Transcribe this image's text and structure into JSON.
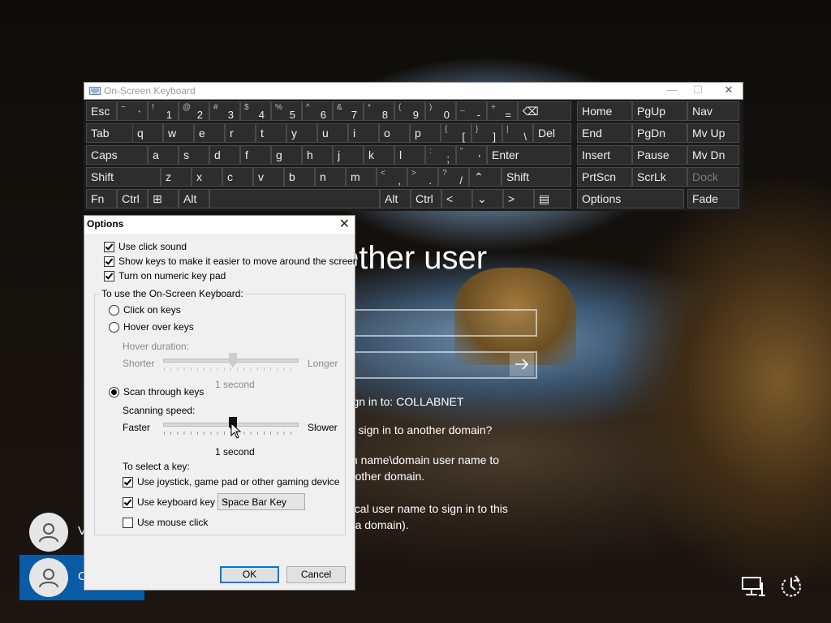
{
  "osk": {
    "title": "On-Screen Keyboard",
    "rows": [
      [
        {
          "main": "Esc"
        },
        {
          "sec": "~",
          "main": "`"
        },
        {
          "sec": "!",
          "main": "1"
        },
        {
          "sec": "@",
          "main": "2"
        },
        {
          "sec": "#",
          "main": "3"
        },
        {
          "sec": "$",
          "main": "4"
        },
        {
          "sec": "%",
          "main": "5"
        },
        {
          "sec": "^",
          "main": "6"
        },
        {
          "sec": "&",
          "main": "7"
        },
        {
          "sec": "*",
          "main": "8"
        },
        {
          "sec": "(",
          "main": "9"
        },
        {
          "sec": ")",
          "main": "0"
        },
        {
          "sec": "_",
          "main": "-"
        },
        {
          "sec": "+",
          "main": "="
        },
        {
          "main": "⌫"
        }
      ],
      [
        {
          "main": "Tab"
        },
        {
          "main": "q"
        },
        {
          "main": "w"
        },
        {
          "main": "e"
        },
        {
          "main": "r"
        },
        {
          "main": "t"
        },
        {
          "main": "y"
        },
        {
          "main": "u"
        },
        {
          "main": "i"
        },
        {
          "main": "o"
        },
        {
          "main": "p"
        },
        {
          "sec": "{",
          "main": "["
        },
        {
          "sec": "}",
          "main": "]"
        },
        {
          "sec": "|",
          "main": "\\"
        },
        {
          "main": "Del"
        }
      ],
      [
        {
          "main": "Caps"
        },
        {
          "main": "a"
        },
        {
          "main": "s"
        },
        {
          "main": "d"
        },
        {
          "main": "f"
        },
        {
          "main": "g"
        },
        {
          "main": "h"
        },
        {
          "main": "j"
        },
        {
          "main": "k"
        },
        {
          "main": "l"
        },
        {
          "sec": ":",
          "main": ";"
        },
        {
          "sec": "\"",
          "main": "'"
        },
        {
          "main": "Enter"
        }
      ],
      [
        {
          "main": "Shift"
        },
        {
          "main": "z"
        },
        {
          "main": "x"
        },
        {
          "main": "c"
        },
        {
          "main": "v"
        },
        {
          "main": "b"
        },
        {
          "main": "n"
        },
        {
          "main": "m"
        },
        {
          "sec": "<",
          "main": ","
        },
        {
          "sec": ">",
          "main": "."
        },
        {
          "sec": "?",
          "main": "/"
        },
        {
          "main": "⌃"
        },
        {
          "main": "Shift"
        }
      ],
      [
        {
          "main": "Fn"
        },
        {
          "main": "Ctrl"
        },
        {
          "main": "⊞"
        },
        {
          "main": "Alt"
        },
        {
          "main": ""
        },
        {
          "main": "Alt"
        },
        {
          "main": "Ctrl"
        },
        {
          "main": "<"
        },
        {
          "main": "⌄"
        },
        {
          "main": ">"
        },
        {
          "main": "▤"
        }
      ]
    ],
    "nav_keys": [
      [
        "Home",
        "PgUp",
        "Nav"
      ],
      [
        "End",
        "PgDn",
        "Mv Up"
      ],
      [
        "Insert",
        "Pause",
        "Mv Dn"
      ],
      [
        "PrtScn",
        "ScrLk",
        "Dock"
      ],
      [
        "Options",
        "",
        "Fade"
      ]
    ]
  },
  "options": {
    "title": "Options",
    "use_click_sound": "Use click sound",
    "show_keys": "Show keys to make it easier to move around the screen",
    "numeric_keypad": "Turn on numeric key pad",
    "group_label": "To use the On-Screen Keyboard:",
    "click_on_keys": "Click on keys",
    "hover_over_keys": "Hover over keys",
    "hover_duration": "Hover duration:",
    "shorter": "Shorter",
    "longer": "Longer",
    "hover_value": "1 second",
    "scan_through_keys": "Scan through keys",
    "scanning_speed": "Scanning speed:",
    "faster": "Faster",
    "slower": "Slower",
    "scan_value": "1 second",
    "to_select_key": "To select a key:",
    "use_joystick": "Use joystick, game pad or other gaming device",
    "use_keyboard_key": "Use keyboard key",
    "keyboard_key_value": "Space Bar Key",
    "use_mouse_click": "Use mouse click",
    "ok": "OK",
    "cancel": "Cancel"
  },
  "signin": {
    "title": "other user",
    "sign_in_to": "Sign in to: COLLABNET",
    "help_question": "o I sign in to another domain?",
    "help_line1": "ain name\\domain user name to",
    "help_line2": "another domain.",
    "help_line3": "\\local user name to sign in to this",
    "help_line4": "ot a domain)."
  },
  "users": [
    {
      "initial": "V"
    },
    {
      "initial": "O"
    }
  ],
  "colors": {
    "accent": "#0078d7",
    "user_selected": "#0a5ba6",
    "key_bg": "#2d2d2d"
  }
}
